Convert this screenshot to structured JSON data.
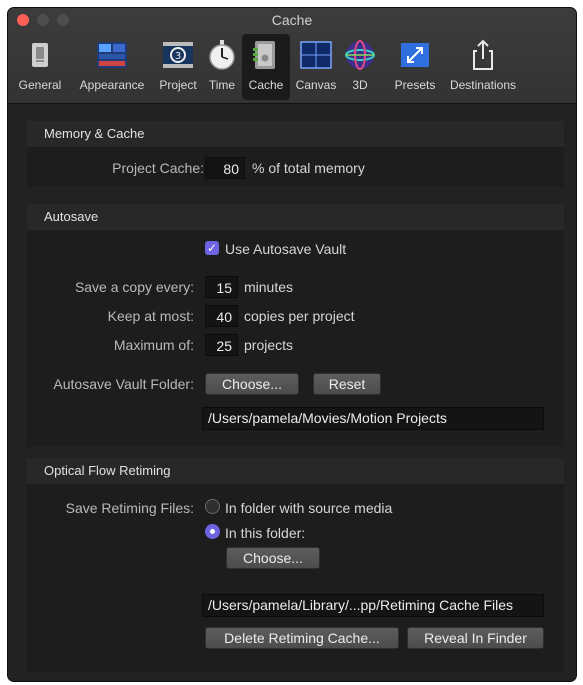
{
  "window": {
    "title": "Cache"
  },
  "toolbar": {
    "items": [
      {
        "label": "General",
        "icon": "general-icon"
      },
      {
        "label": "Appearance",
        "icon": "appearance-icon"
      },
      {
        "label": "Project",
        "icon": "project-icon"
      },
      {
        "label": "Time",
        "icon": "stopwatch-icon"
      },
      {
        "label": "Cache",
        "icon": "cache-icon",
        "selected": true
      },
      {
        "label": "Canvas",
        "icon": "canvas-icon"
      },
      {
        "label": "3D",
        "icon": "3d-sphere-icon"
      },
      {
        "label": "Presets",
        "icon": "presets-icon"
      },
      {
        "label": "Destinations",
        "icon": "share-icon"
      }
    ]
  },
  "memory": {
    "header": "Memory & Cache",
    "project_cache_label": "Project Cache:",
    "project_cache_value": "80",
    "project_cache_unit": "% of total memory"
  },
  "autosave": {
    "header": "Autosave",
    "use_vault_label": "Use Autosave Vault",
    "use_vault_checked": true,
    "save_copy_label": "Save a copy every:",
    "save_copy_value": "15",
    "save_copy_unit": "minutes",
    "keep_label": "Keep at most:",
    "keep_value": "40",
    "keep_unit": "copies per project",
    "max_label": "Maximum of:",
    "max_value": "25",
    "max_unit": "projects",
    "folder_label": "Autosave Vault Folder:",
    "choose_button": "Choose...",
    "reset_button": "Reset",
    "folder_path": "/Users/pamela/Movies/Motion Projects"
  },
  "retiming": {
    "header": "Optical Flow Retiming",
    "save_label": "Save Retiming Files:",
    "option_source": "In folder with source media",
    "option_this_folder": "In this folder:",
    "selected_option": "In this folder:",
    "choose_button": "Choose...",
    "folder_path": "/Users/pamela/Library/...pp/Retiming Cache Files",
    "delete_button": "Delete Retiming Cache...",
    "reveal_button": "Reveal In Finder"
  },
  "colors": {
    "accent": "#6e63e0",
    "close": "#ff5f57",
    "background": "#222222"
  }
}
